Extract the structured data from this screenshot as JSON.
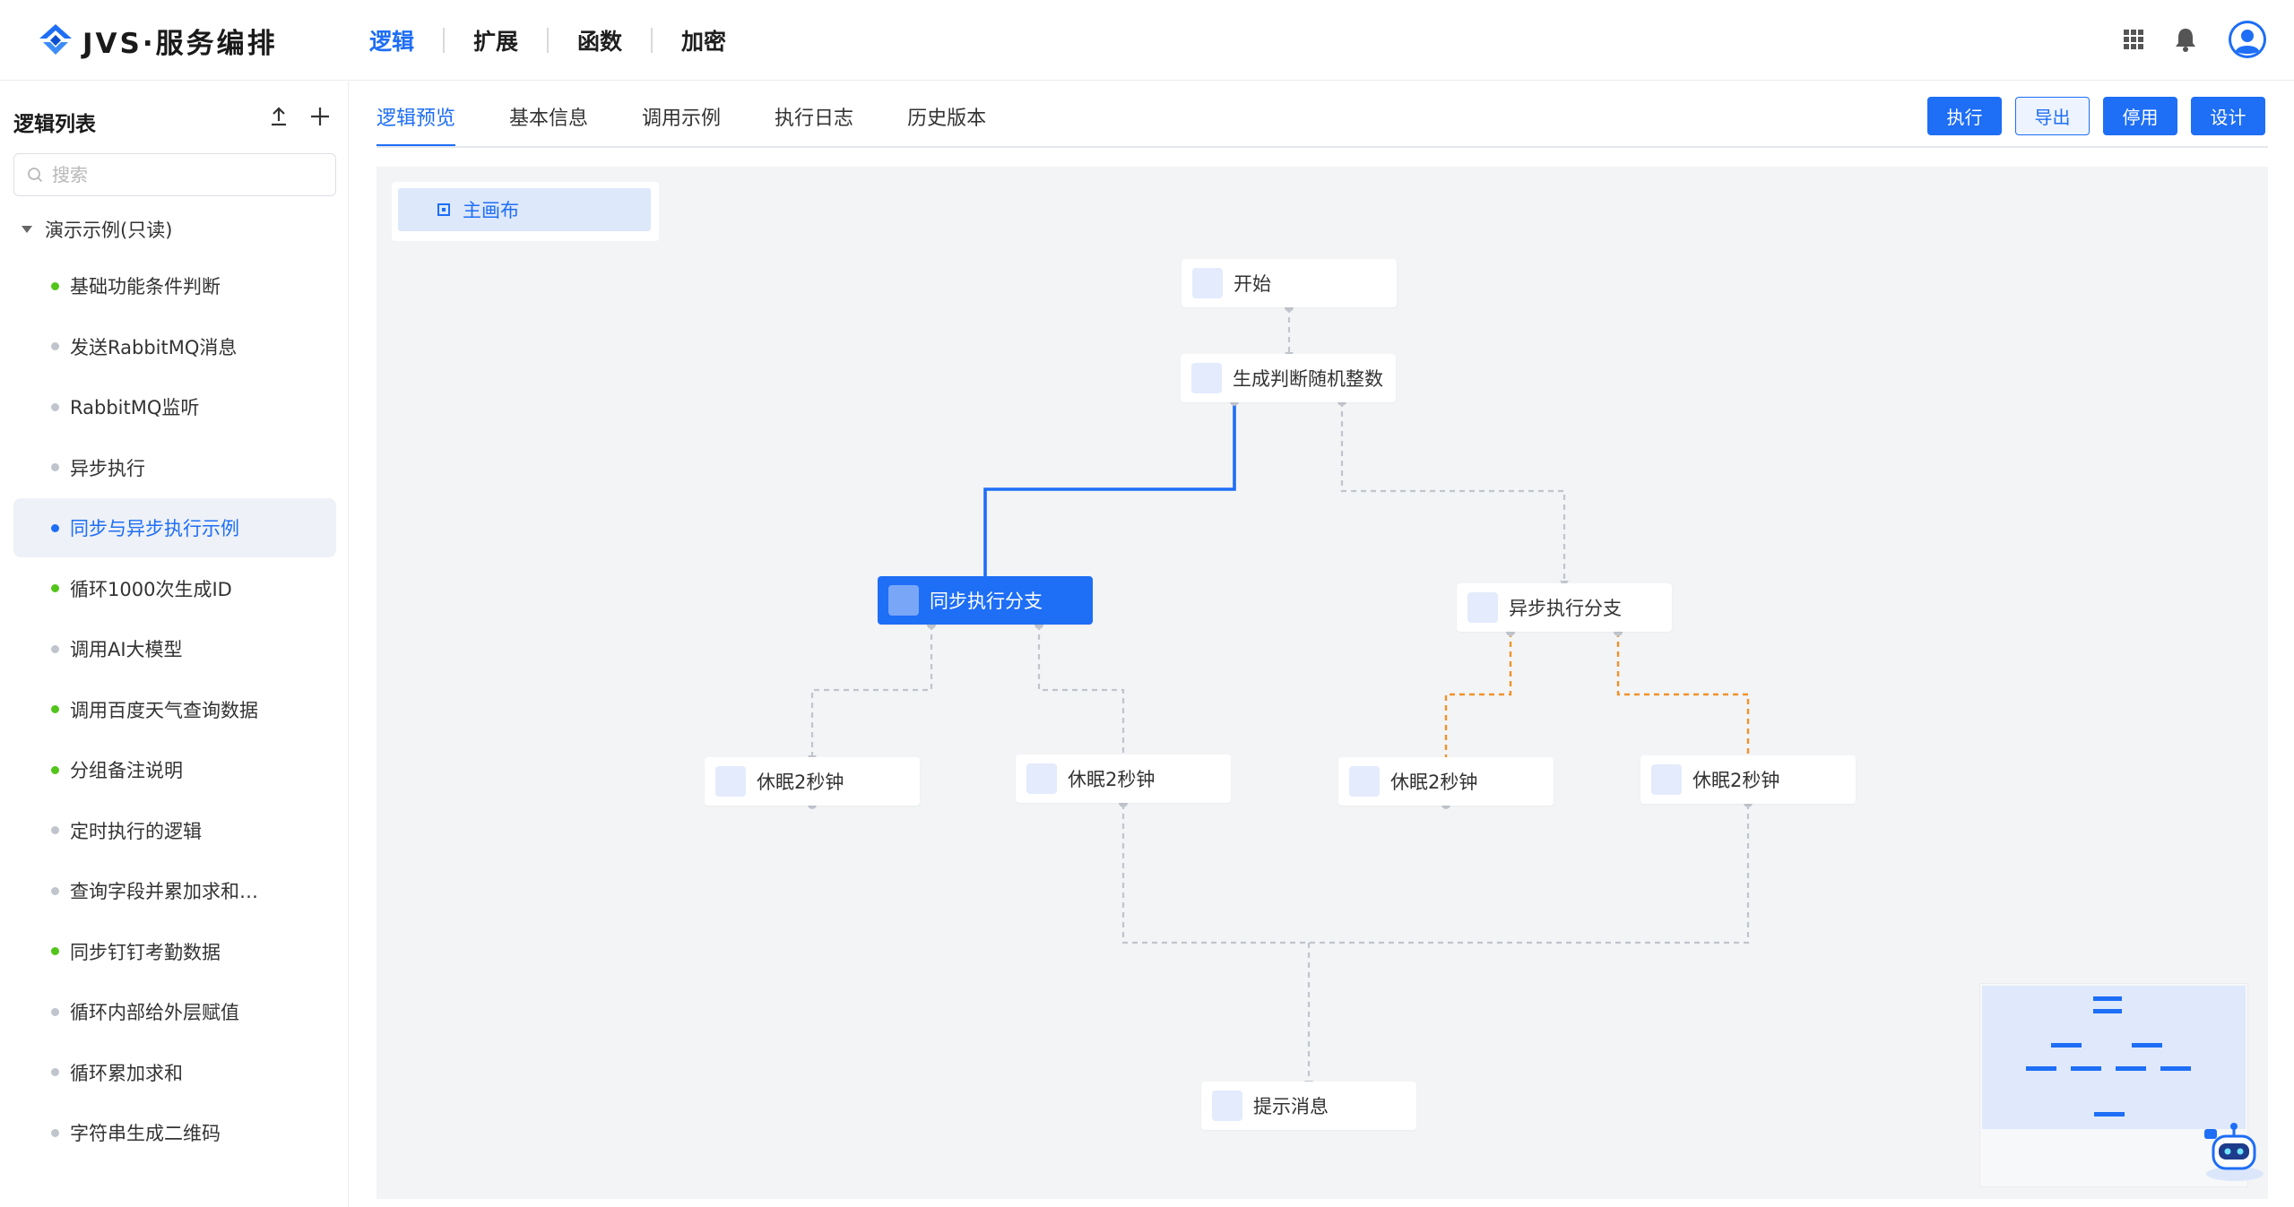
{
  "header": {
    "logo_text": "JVS·服务编排",
    "nav": [
      "逻辑",
      "扩展",
      "函数",
      "加密"
    ],
    "active_nav": "逻辑",
    "icons": [
      "apps-grid-icon",
      "bell-icon",
      "user-avatar-icon"
    ]
  },
  "sidebar": {
    "title": "逻辑列表",
    "search_placeholder": "搜索",
    "root_label": "演示示例(只读)",
    "items": [
      {
        "label": "基础功能条件判断",
        "status": "green"
      },
      {
        "label": "发送RabbitMQ消息",
        "status": "gray"
      },
      {
        "label": "RabbitMQ监听",
        "status": "gray"
      },
      {
        "label": "异步执行",
        "status": "gray"
      },
      {
        "label": "同步与异步执行示例",
        "status": "blue"
      },
      {
        "label": "循环1000次生成ID",
        "status": "green"
      },
      {
        "label": "调用AI大模型",
        "status": "gray"
      },
      {
        "label": "调用百度天气查询数据",
        "status": "green"
      },
      {
        "label": "分组备注说明",
        "status": "green"
      },
      {
        "label": "定时执行的逻辑",
        "status": "gray"
      },
      {
        "label": "查询字段并累加求和…",
        "status": "gray"
      },
      {
        "label": "同步钉钉考勤数据",
        "status": "green"
      },
      {
        "label": "循环内部给外层赋值",
        "status": "gray"
      },
      {
        "label": "循环累加求和",
        "status": "gray"
      },
      {
        "label": "字符串生成二维码",
        "status": "gray"
      }
    ],
    "active_index": 4
  },
  "tabs": [
    "逻辑预览",
    "基本信息",
    "调用示例",
    "执行日志",
    "历史版本"
  ],
  "active_tab": "逻辑预览",
  "actions": {
    "execute": "执行",
    "export": "导出",
    "disable": "停用",
    "design": "设计"
  },
  "canvas": {
    "canvas_tab": "主画布",
    "nodes": {
      "start": "开始",
      "random": "生成判断随机整数",
      "sync_branch": "同步执行分支",
      "async_branch": "异步执行分支",
      "sleep1": "休眠2秒钟",
      "sleep2": "休眠2秒钟",
      "sleep3": "休眠2秒钟",
      "sleep4": "休眠2秒钟",
      "message": "提示消息"
    },
    "selected_node": "sync_branch"
  },
  "colors": {
    "primary": "#1e6ef6",
    "status_green": "#52c41a",
    "status_gray": "#c0c4cc",
    "status_blue": "#1e6ef6",
    "async_edge": "#f0922b",
    "edge": "#c0c4cc"
  }
}
